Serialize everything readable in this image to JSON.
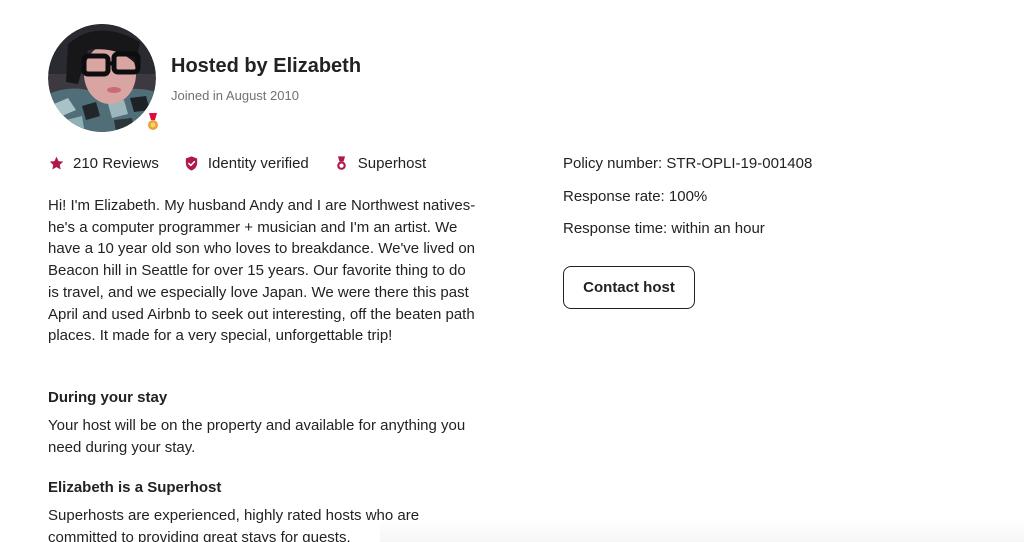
{
  "host": {
    "title": "Hosted by Elizabeth",
    "joined": "Joined in August 2010",
    "avatar_alt": "Elizabeth",
    "badge_icon": "superhost-medal-icon"
  },
  "stats": [
    {
      "icon": "star-icon",
      "label": "210 Reviews"
    },
    {
      "icon": "verified-shield-icon",
      "label": "Identity verified"
    },
    {
      "icon": "superhost-medal-icon",
      "label": "Superhost"
    }
  ],
  "bio": "Hi! I'm Elizabeth. My husband Andy and I are Northwest natives- he's a computer programmer + musician and I'm an artist. We have a 10 year old son who loves to breakdance. We've lived on Beacon hill in Seattle for over 15 years. Our favorite thing to do is travel, and we especially love Japan. We were there this past April and used Airbnb to seek out interesting, off the beaten path places. It made for a very special, unforgettable trip!",
  "during_stay": {
    "heading": "During your stay",
    "text": "Your host will be on the property and available for anything you need during your stay."
  },
  "superhost": {
    "heading": "Elizabeth is a Superhost",
    "text": "Superhosts are experienced, highly rated hosts who are committed to providing great stays for guests."
  },
  "details": {
    "policy_number": "Policy number: STR-OPLI-19-001408",
    "response_rate": "Response rate: 100%",
    "response_time": "Response time: within an hour"
  },
  "contact_button": "Contact host",
  "colors": {
    "accent": "#E00B41",
    "accent_dark": "#B0174A",
    "text": "#222222",
    "muted": "#717171"
  }
}
